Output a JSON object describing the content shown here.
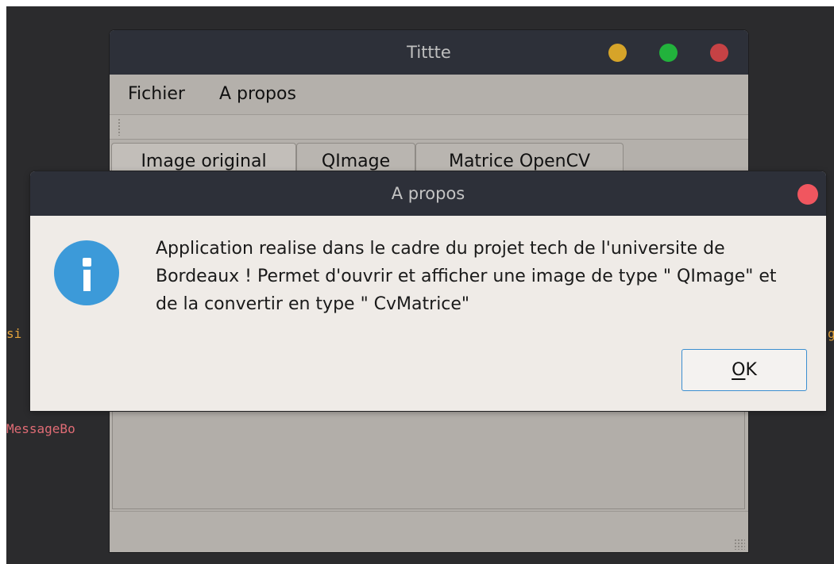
{
  "code_fragments": {
    "left_line1": "si",
    "left_line2": "MessageBo",
    "right_line1": "g"
  },
  "main_window": {
    "title": "Tittte",
    "controls": {
      "minimize_color": "#d6a429",
      "maximize_color": "#22b23c",
      "close_color": "#c64245"
    },
    "menu": [
      "Fichier",
      "A propos"
    ],
    "tabs": [
      "Image original",
      "QImage",
      "Matrice OpenCV"
    ]
  },
  "dialog": {
    "title": "A propos",
    "close_color": "#f0565f",
    "icon": "info-icon",
    "message": "Application realise dans le cadre du projet tech de l'universite de Bordeaux ! Permet d'ouvrir et afficher une image de type \" QImage\" et de la convertir en type \" CvMatrice\"",
    "ok_button": {
      "mnemonic": "O",
      "rest": "K"
    },
    "accent_color": "#3c9ad9"
  }
}
